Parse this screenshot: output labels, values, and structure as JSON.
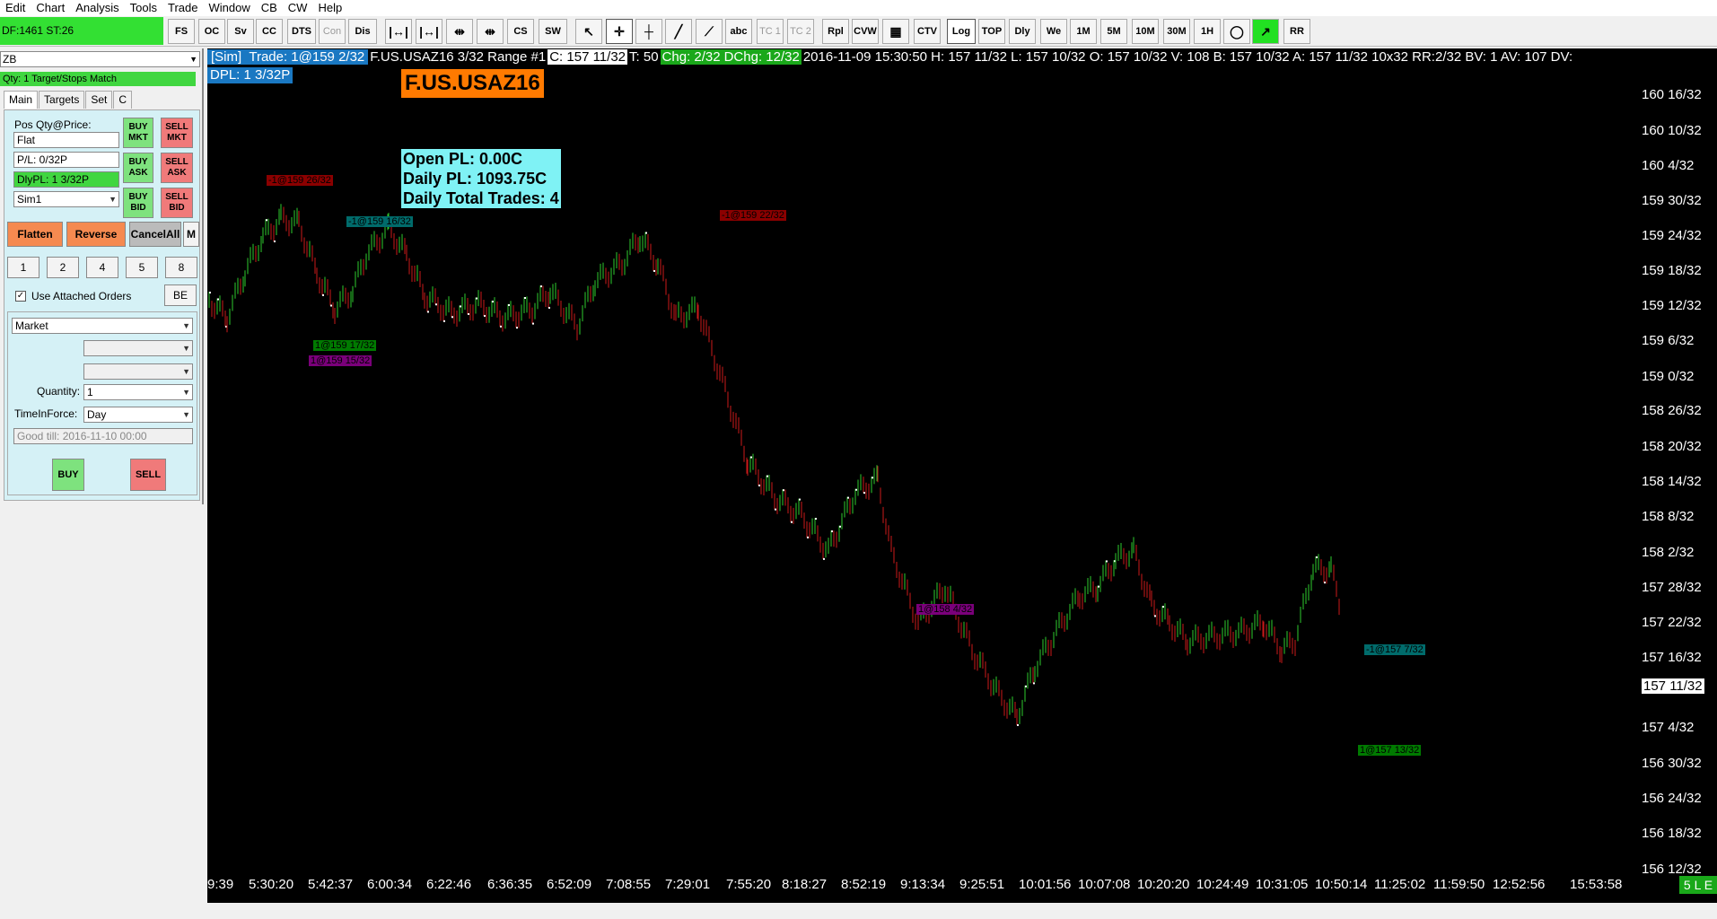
{
  "menu": [
    "Edit",
    "Chart",
    "Analysis",
    "Tools",
    "Trade",
    "Window",
    "CB",
    "CW",
    "Help"
  ],
  "toolbar": {
    "df_text": "DF:1461  ST:26",
    "buttons": [
      "FS",
      "OC",
      "Sv",
      "CC",
      "DTS",
      "Con",
      "Dis",
      "",
      "",
      "",
      "",
      "CS",
      "SW",
      "",
      "",
      "",
      "",
      "",
      "abc",
      "TC 1",
      "TC 2",
      "Rpl",
      "CVW",
      "",
      "CTV",
      "Log",
      "TOP",
      "Dly",
      "We",
      "1M",
      "5M",
      "10M",
      "30M",
      "1H",
      "",
      "",
      "RR"
    ]
  },
  "panel": {
    "symbol": "ZB",
    "qty_match": "Qty: 1 Target/Stops Match",
    "tabs": [
      "Main",
      "Targets",
      "Set",
      "C"
    ],
    "pos_label": "Pos Qty@Price:",
    "pos_value": "Flat",
    "pl_value": "P/L: 0/32P",
    "dlypl_value": "DlyPL: 1 3/32P",
    "account": "Sim1",
    "buy_mkt": "BUY MKT",
    "sell_mkt": "SELL MKT",
    "buy_ask": "BUY ASK",
    "sell_ask": "SELL ASK",
    "buy_bid": "BUY BID",
    "sell_bid": "SELL BID",
    "flatten": "Flatten",
    "reverse": "Reverse",
    "cancel_all": "CancelAll",
    "m": "M",
    "qty_buttons": [
      "1",
      "2",
      "4",
      "5",
      "8"
    ],
    "use_attached": "Use Attached Orders",
    "be": "BE",
    "order_type": "Market",
    "quantity_label": "Quantity:",
    "quantity_value": "1",
    "tif_label": "TimeInForce:",
    "tif_value": "Day",
    "good_till": "Good till: 2016-11-10 00:00",
    "buy": "BUY",
    "sell": "SELL"
  },
  "chart": {
    "header": {
      "sim": "[Sim]",
      "trade": "Trade: 1@159 2/32",
      "symbol_range": "F.US.USAZ16  3/32 Range  #1",
      "close": "C: 157 11/32",
      "t": "T: 50",
      "chg": "Chg: 2/32",
      "dchg": "DChg: 12/32",
      "rest": "2016-11-09 15:30:50  H: 157 11/32  L: 157 10/32  O: 157 10/32  V: 108  B: 157 10/32  A: 157 11/32  10x32  RR:2/32  BV: 1  AV: 107  DV:"
    },
    "dpl": "DPL: 1 3/32P",
    "title": "F.US.USAZ16",
    "open_pl": "Open PL: 0.00C",
    "daily_pl": "Daily PL: 1093.75C",
    "daily_trades": "Daily Total Trades: 4",
    "y_labels": [
      "160 16/32",
      "160 10/32",
      "160 4/32",
      "159 30/32",
      "159 24/32",
      "159 18/32",
      "159 12/32",
      "159 6/32",
      "159 0/32",
      "158 26/32",
      "158 20/32",
      "158 14/32",
      "158 8/32",
      "158 2/32",
      "157 28/32",
      "157 22/32",
      "157 16/32",
      "157 4/32",
      "156 30/32",
      "156 24/32",
      "156 18/32",
      "156 12/32"
    ],
    "current_price": "157 11/32",
    "x_labels": [
      "9:39",
      "5:30:20",
      "5:42:37",
      "6:00:34",
      "6:22:46",
      "6:36:35",
      "6:52:09",
      "7:08:55",
      "7:29:01",
      "7:55:20",
      "8:18:27",
      "8:52:19",
      "9:13:34",
      "9:25:51",
      "10:01:56",
      "10:07:08",
      "10:20:20",
      "10:24:49",
      "10:31:05",
      "10:50:14",
      "11:25:02",
      "11:59:50",
      "12:52:56",
      "15:53:58"
    ],
    "le": "5 L E",
    "trade_labels": [
      {
        "text": "-1@159 26/32",
        "style": "red"
      },
      {
        "text": "-1@159 16/32",
        "style": "teal"
      },
      {
        "text": "1@159 17/32",
        "style": "green"
      },
      {
        "text": "1@159 15/32",
        "style": "purple"
      },
      {
        "text": "-1@159 22/32",
        "style": "red"
      },
      {
        "text": "1@158 4/32",
        "style": "purple"
      },
      {
        "text": "-1@157 7/32",
        "style": "teal"
      },
      {
        "text": "1@157 13/32",
        "style": "green"
      }
    ],
    "colors": {
      "up": "#2ecc2e",
      "down": "#cc1a1a",
      "close_tick": "#ffffff"
    }
  }
}
